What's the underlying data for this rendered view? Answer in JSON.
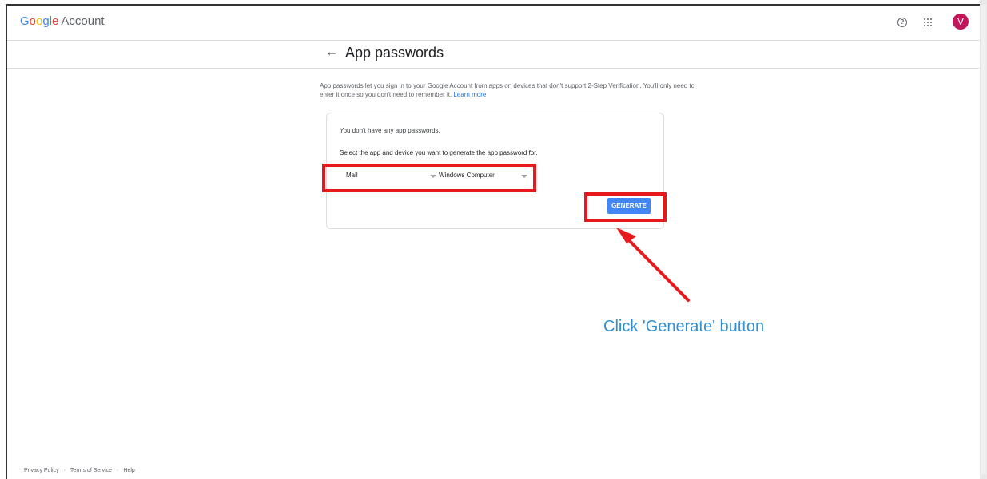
{
  "header": {
    "logo_google": "Google",
    "logo_account": "Account",
    "help_icon": "help-circle-icon",
    "apps_icon": "apps-grid-icon",
    "avatar_letter": "V"
  },
  "subheader": {
    "back_icon": "←",
    "title": "App passwords"
  },
  "intro": {
    "text": "App passwords let you sign in to your Google Account from apps on devices that don't support 2-Step Verification. You'll only need to enter it once so you don't need to remember it.",
    "learn_more": "Learn more"
  },
  "card": {
    "empty_message": "You don't have any app passwords.",
    "select_prompt": "Select the app and device you want to generate the app password for.",
    "app_select": "Mail",
    "device_select": "Windows Computer",
    "generate_label": "GENERATE"
  },
  "annotation": {
    "text": "Click 'Generate' button",
    "highlight_color": "#e8191c",
    "text_color": "#2f8fd0"
  },
  "footer": {
    "links": [
      "Privacy Policy",
      "Terms of Service",
      "Help"
    ]
  }
}
